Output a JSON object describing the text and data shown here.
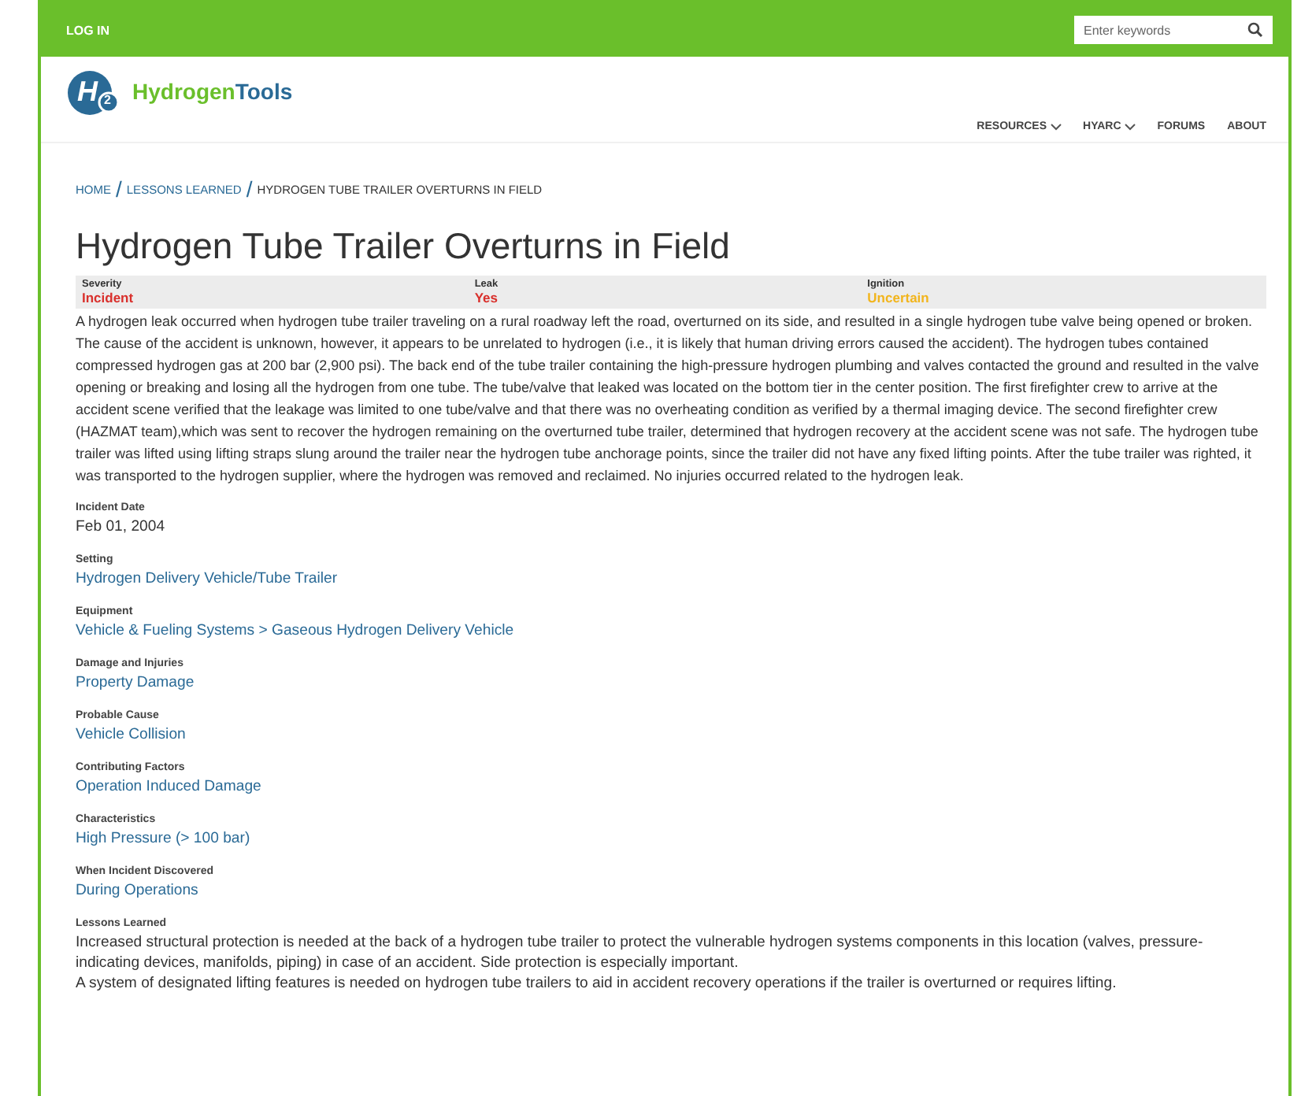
{
  "top_bar": {
    "login": "LOG IN",
    "search": {
      "placeholder": "Enter keywords"
    }
  },
  "logo": {
    "mark": "H",
    "subscript": "2",
    "name_part_1": "Hydrogen",
    "name_part_2": "Tools"
  },
  "nav": [
    {
      "label": "RESOURCES",
      "dropdown": true
    },
    {
      "label": "HYARC",
      "dropdown": true
    },
    {
      "label": "FORUMS",
      "dropdown": false
    },
    {
      "label": "ABOUT",
      "dropdown": false
    }
  ],
  "breadcrumb": [
    {
      "label": "HOME",
      "link": true
    },
    {
      "separator": "/",
      "label": "LESSONS LEARNED",
      "link": true
    },
    {
      "separator": "/",
      "label": "HYDROGEN TUBE TRAILER OVERTURNS IN FIELD",
      "link": false
    }
  ],
  "title": "Hydrogen Tube Trailer Overturns in Field",
  "stats": [
    {
      "label": "Severity",
      "value": "Incident",
      "color": "#d9302c"
    },
    {
      "label": "Leak",
      "value": "Yes",
      "color": "#d9302c"
    },
    {
      "label": "Ignition",
      "value": "Uncertain",
      "color": "#f2b51d"
    }
  ],
  "description": "A hydrogen leak occurred when hydrogen tube trailer traveling on a rural roadway left the road, overturned on its side, and resulted in a single hydrogen tube valve being opened or broken. The cause of the accident is unknown, however, it appears to be unrelated to hydrogen (i.e., it is likely that human driving errors caused the accident). The hydrogen tubes contained compressed hydrogen gas at 200 bar (2,900 psi). The back end of the tube trailer containing the high-pressure hydrogen plumbing and valves contacted the ground and resulted in the valve opening or breaking and losing all the hydrogen from one tube. The tube/valve that leaked was located on the bottom tier in the center position. The first firefighter crew to arrive at the accident scene verified that the leakage was limited to one tube/valve and that there was no overheating condition as verified by a thermal imaging device. The second firefighter crew (HAZMAT team),which was sent to recover the hydrogen remaining on the overturned tube trailer, determined that hydrogen recovery at the accident scene was not safe. The hydrogen tube trailer was lifted using lifting straps slung around the trailer near the hydrogen tube anchorage points, since the trailer did not have any fixed lifting points. After the tube trailer was righted, it was transported to the hydrogen supplier, where the hydrogen was removed and reclaimed. No injuries occurred related to the hydrogen leak.",
  "fields": [
    {
      "label": "Incident Date",
      "kind": "text",
      "values": [
        "Feb 01, 2004"
      ]
    },
    {
      "label": "Setting",
      "kind": "link",
      "values": [
        "Hydrogen Delivery Vehicle/Tube Trailer"
      ]
    },
    {
      "label": "Equipment",
      "kind": "link",
      "values": [
        "Vehicle & Fueling Systems > Gaseous Hydrogen Delivery Vehicle"
      ]
    },
    {
      "label": "Damage and Injuries",
      "kind": "link",
      "values": [
        "Property Damage"
      ]
    },
    {
      "label": "Probable Cause",
      "kind": "link",
      "values": [
        "Vehicle Collision"
      ]
    },
    {
      "label": "Contributing Factors",
      "kind": "link",
      "values": [
        "Operation Induced Damage"
      ]
    },
    {
      "label": "Characteristics",
      "kind": "link",
      "values": [
        "High Pressure (> 100 bar)"
      ]
    },
    {
      "label": "When Incident Discovered",
      "kind": "link",
      "values": [
        "During Operations"
      ]
    },
    {
      "label": "Lessons Learned",
      "kind": "text",
      "values": [
        "Increased structural protection is needed at the back of a hydrogen tube trailer to protect the vulnerable hydrogen systems components in this location (valves, pressure-indicating devices, manifolds, piping) in case of an accident. Side protection is especially important.",
        "A system of designated lifting features is needed on hydrogen tube trailers to aid in accident recovery operations if the trailer is overturned or requires lifting."
      ]
    }
  ]
}
